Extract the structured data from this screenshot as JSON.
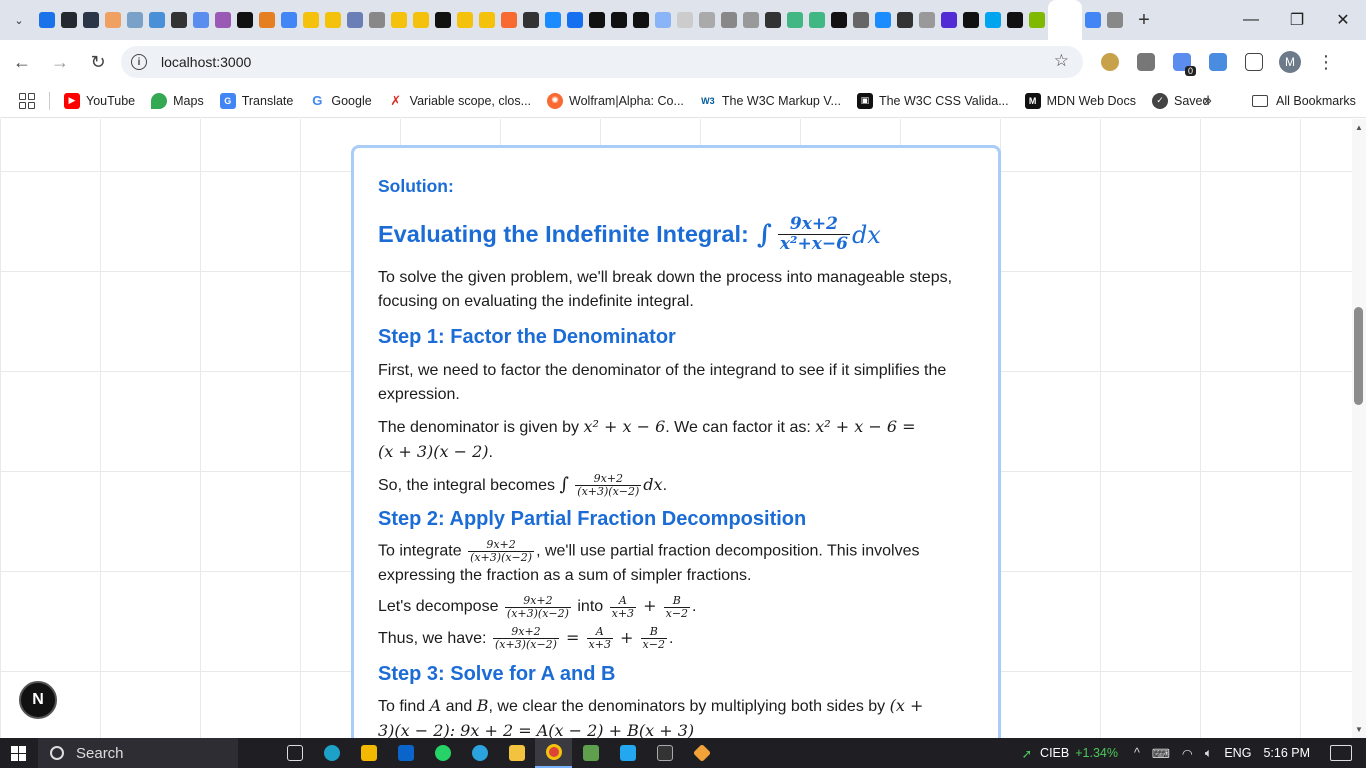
{
  "browser": {
    "tab_close": "✕",
    "new_tab": "+",
    "window_controls": [
      "—",
      "❐",
      "✕"
    ],
    "url": "localhost:3000",
    "profile_initial": "M",
    "extension_badge": "0"
  },
  "bookmarks": {
    "items": [
      {
        "label": "YouTube",
        "icon": "youtube-icon",
        "color": "#ff0000"
      },
      {
        "label": "Maps",
        "icon": "maps-icon",
        "color": "#34a853"
      },
      {
        "label": "Translate",
        "icon": "translate-icon",
        "color": "#4285f4"
      },
      {
        "label": "Google",
        "icon": "google-icon",
        "color": "#4285f4"
      },
      {
        "label": "Variable scope, clos...",
        "icon": "mdn-icon",
        "color": "#d93025"
      },
      {
        "label": "Wolfram|Alpha: Co...",
        "icon": "wolfram-icon",
        "color": "#f96932"
      },
      {
        "label": "The W3C Markup V...",
        "icon": "w3c-icon",
        "color": "#005a9c"
      },
      {
        "label": "The W3C CSS Valida...",
        "icon": "w3c-css-icon",
        "color": "#111111"
      },
      {
        "label": "MDN Web Docs",
        "icon": "mdn-logo-icon",
        "color": "#111111"
      },
      {
        "label": "Saved",
        "icon": "saved-icon",
        "color": "#444444"
      }
    ],
    "more": "»",
    "all_bookmarks": "All Bookmarks"
  },
  "solution": {
    "label": "Solution:",
    "title": "Evaluating the Indefinite Integral:",
    "title_integral": {
      "num": "9x+2",
      "den": "x²+x−6",
      "dx": "dx"
    },
    "intro": "To solve the given problem, we'll break down the process into manageable steps, focusing on evaluating the indefinite integral.",
    "step1": {
      "heading": "Step 1: Factor the Denominator",
      "p1": "First, we need to factor the denominator of the integrand to see if it simplifies the expression.",
      "p2_a": "The denominator is given by ",
      "p2_math1": "x² + x − 6",
      "p2_b": ". We can factor it as: ",
      "p2_math2": "x² + x − 6 =",
      "p2_math3": "(x + 3)(x − 2)",
      "p3_a": "So, the integral becomes ",
      "p3_num": "9x+2",
      "p3_den": "(x+3)(x−2)",
      "p3_dx": "dx"
    },
    "step2": {
      "heading": "Step 2: Apply Partial Fraction Decomposition",
      "p1_a": "To integrate ",
      "p1_num": "9x+2",
      "p1_den": "(x+3)(x−2)",
      "p1_b": ", we'll use partial fraction decomposition. This involves expressing the fraction as a sum of simpler fractions.",
      "p2_a": "Let's decompose ",
      "p2_into": " into ",
      "p3_a": "Thus, we have: ",
      "frac_A": {
        "num": "A",
        "den": "x+3"
      },
      "frac_B": {
        "num": "B",
        "den": "x−2"
      }
    },
    "step3": {
      "heading": "Step 3: Solve for A and B",
      "p1_a": "To find ",
      "p1_A": "A",
      "p1_and": " and ",
      "p1_B": "B",
      "p1_b": ", we clear the denominators by multiplying both sides by ",
      "p1_math": "(x +",
      "p1_line2": "3)(x − 2): 9x + 2 = A(x − 2) + B(x + 3)"
    }
  },
  "dev_badge": "N",
  "taskbar": {
    "search": "Search",
    "ticker": "CIEB",
    "change": "+1.34%",
    "language": "ENG",
    "time": "5:16 PM"
  }
}
